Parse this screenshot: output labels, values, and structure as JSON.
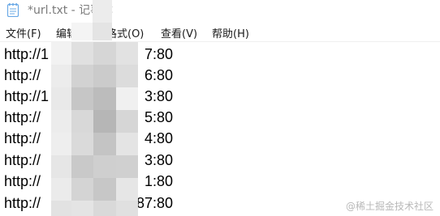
{
  "window": {
    "title": "*url.txt - 记事本"
  },
  "menu": {
    "items": [
      {
        "label": "文件(F)"
      },
      {
        "label": "编辑(E)"
      },
      {
        "label": "格式(O)"
      },
      {
        "label": "查看(V)"
      },
      {
        "label": "帮助(H)"
      }
    ]
  },
  "editor": {
    "lines": [
      {
        "visible_start": "http://1",
        "visible_end": "7:80"
      },
      {
        "visible_start": "http://",
        "visible_end": "6:80"
      },
      {
        "visible_start": "http://1",
        "visible_end": "3:80"
      },
      {
        "visible_start": "http://",
        "visible_end": "5:80"
      },
      {
        "visible_start": "http://",
        "visible_end": "4:80"
      },
      {
        "visible_start": "http://",
        "visible_end": "3:80"
      },
      {
        "visible_start": "http://",
        "visible_end": "1:80"
      },
      {
        "visible_start": "http://",
        "visible_end": "87:80"
      }
    ]
  },
  "watermark": {
    "text": "@稀土掘金技术社区"
  },
  "colors": {
    "title_text": "#7a7a7a",
    "menu_text": "#1a1a1a",
    "editor_text": "#000000",
    "mosaic_light": "#e8e8e8",
    "mosaic_mid": "#cfcfcf",
    "mosaic_dark": "#b4b4b4"
  },
  "icons": {
    "app_icon": "notepad-icon"
  }
}
